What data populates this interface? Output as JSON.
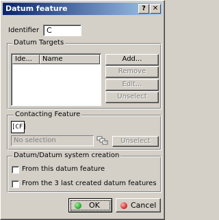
{
  "window": {
    "title": "Datum feature",
    "help_glyph": "?",
    "close_glyph": "✕"
  },
  "identifier": {
    "label": "Identifier",
    "value": "C"
  },
  "datum_targets": {
    "group_title": "Datum Targets",
    "columns": [
      "Ide...",
      "Name"
    ],
    "rows": [],
    "buttons": {
      "add": "Add...",
      "remove": "Remove",
      "edit": "Edit...",
      "unselect": "Unselect"
    }
  },
  "contacting_feature": {
    "group_title": "Contacting Feature",
    "cf_button_label": "[CF]",
    "selection_value": "No selection",
    "unselect": "Unselect"
  },
  "system_creation": {
    "group_title": "Datum/Datum system creation",
    "options": [
      {
        "label": "From this datum feature",
        "checked": false
      },
      {
        "label": "From the 3 last created datum features",
        "checked": false
      }
    ]
  },
  "footer": {
    "ok": "OK",
    "cancel": "Cancel",
    "ok_color": "#1fa31f",
    "cancel_color": "#d42020"
  }
}
